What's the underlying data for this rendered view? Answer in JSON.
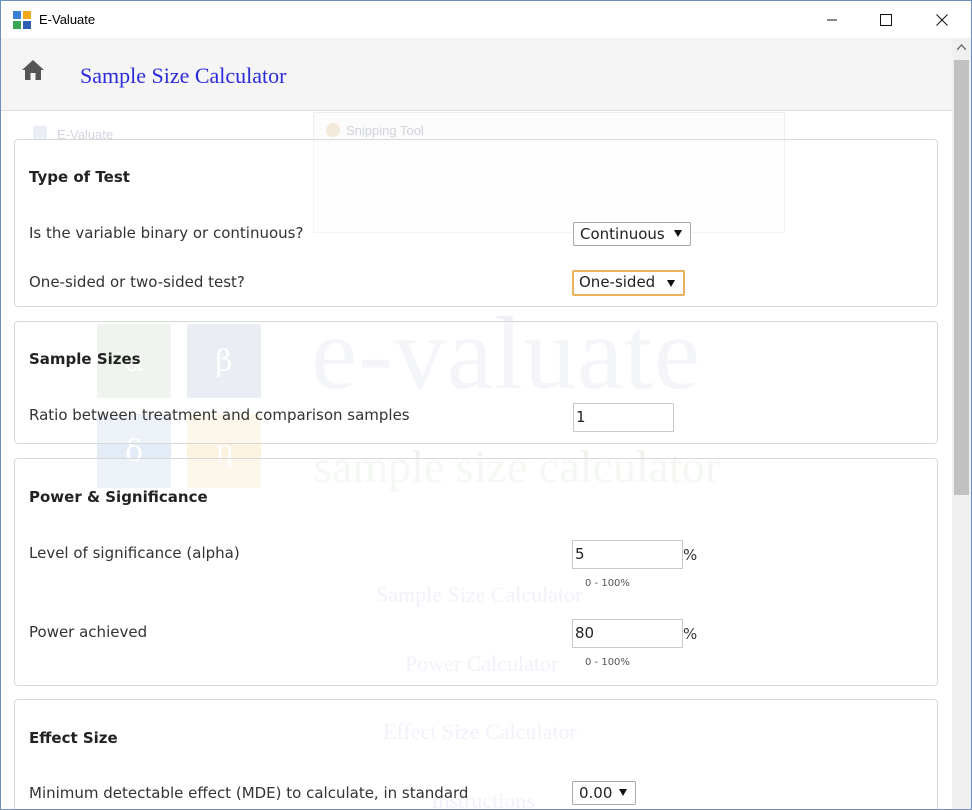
{
  "window": {
    "title": "E-Valuate",
    "icon_name": "app-grid-icon",
    "controls": [
      "minimize-icon",
      "maximize-icon",
      "close-icon"
    ]
  },
  "header": {
    "home_icon": "home-icon",
    "title": "Sample Size Calculator"
  },
  "watermark": {
    "window_title": "E-Valuate",
    "snipping_tool": "Snipping Tool",
    "brand": "e-valuate",
    "tagline": "sample size calculator",
    "tiles": [
      "α",
      "β",
      "δ",
      "η"
    ],
    "menu": [
      "Sample Size Calculator",
      "Power Calculator",
      "Effect Size Calculator",
      "Instructions"
    ]
  },
  "type_of_test": {
    "title": "Type of Test",
    "variable_label": "Is the variable binary or continuous?",
    "variable_value": "Continuous",
    "sided_label": "One-sided or two-sided test?",
    "sided_value": "One-sided"
  },
  "sample_sizes": {
    "title": "Sample Sizes",
    "ratio_label": "Ratio between treatment and comparison samples",
    "ratio_value": "1"
  },
  "power_significance": {
    "title": "Power & Significance",
    "alpha_label": "Level of significance (alpha)",
    "alpha_value": "5",
    "alpha_unit": "%",
    "alpha_hint": "0 - 100%",
    "power_label": "Power achieved",
    "power_value": "80",
    "power_unit": "%",
    "power_hint": "0 - 100%"
  },
  "effect_size": {
    "title": "Effect Size",
    "mde_label": "Minimum detectable effect (MDE) to calculate, in standard",
    "mde_value": "0.00"
  },
  "colors": {
    "title_blue": "#2b2bdb",
    "focus_orange": "#e8b25a",
    "tile_alpha": "#e8efe6",
    "tile_beta": "#dfe3ef",
    "tile_delta": "#e3ebf6",
    "tile_eta": "#fbf2e0"
  }
}
